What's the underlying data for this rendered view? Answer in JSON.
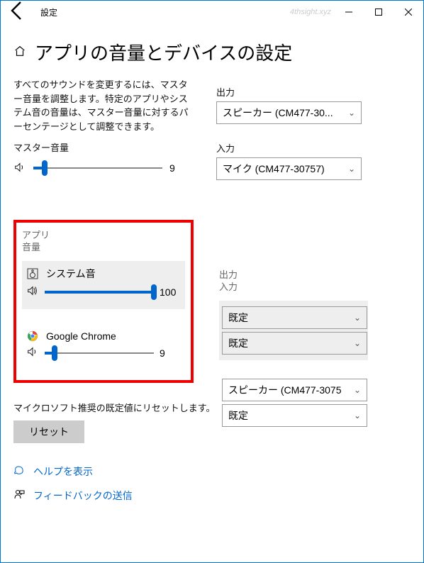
{
  "titlebar": {
    "title": "設定",
    "watermark": "4thsight.xyz"
  },
  "page": {
    "heading": "アプリの音量とデバイスの設定",
    "description": "すべてのサウンドを変更するには、マスター音量を調整します。特定のアプリやシステム音の音量は、マスター音量に対するパーセンテージとして調整できます。",
    "master_volume_label": "マスター音量",
    "master_volume_value": "9",
    "master_volume_percent": 9
  },
  "output": {
    "label": "出力",
    "value": "スピーカー (CM477-30..."
  },
  "input": {
    "label": "入力",
    "value": "マイク (CM477-30757)"
  },
  "apps_section": {
    "col1_line1": "アプリ",
    "col1_line2": "音量",
    "col2_line1": "出力",
    "col2_line2": "入力"
  },
  "apps": [
    {
      "name": "システム音",
      "volume_value": "100",
      "volume_percent": 100,
      "output": "既定",
      "input": "既定",
      "shaded": true
    },
    {
      "name": "Google Chrome",
      "volume_value": "9",
      "volume_percent": 9,
      "output": "スピーカー (CM477-3075",
      "input": "既定",
      "shaded": false
    }
  ],
  "reset": {
    "desc": "マイクロソフト推奨の既定値にリセットします。",
    "button": "リセット"
  },
  "footer": {
    "help": "ヘルプを表示",
    "feedback": "フィードバックの送信"
  }
}
